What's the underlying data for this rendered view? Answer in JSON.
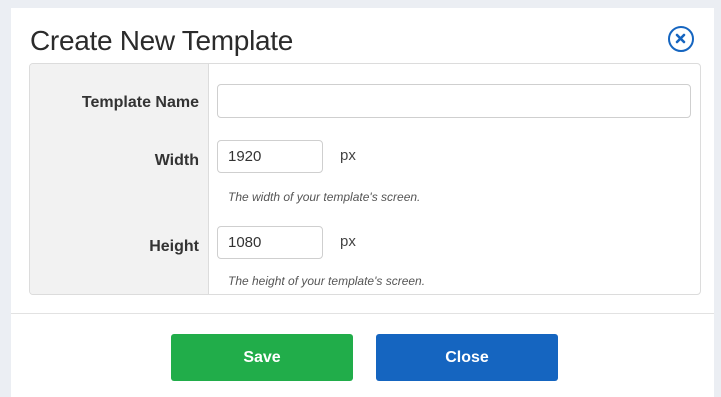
{
  "dialog": {
    "title": "Create New Template",
    "close_icon": "close-circle-icon"
  },
  "form": {
    "template_name": {
      "label": "Template Name",
      "value": "",
      "placeholder": ""
    },
    "width": {
      "label": "Width",
      "value": "1920",
      "unit": "px",
      "help": "The width of your template's screen."
    },
    "height": {
      "label": "Height",
      "value": "1080",
      "unit": "px",
      "help": "The height of your template's screen."
    }
  },
  "footer": {
    "save_label": "Save",
    "close_label": "Close"
  },
  "colors": {
    "save": "#21ad4a",
    "close": "#1565c0",
    "accent": "#1565c0"
  }
}
